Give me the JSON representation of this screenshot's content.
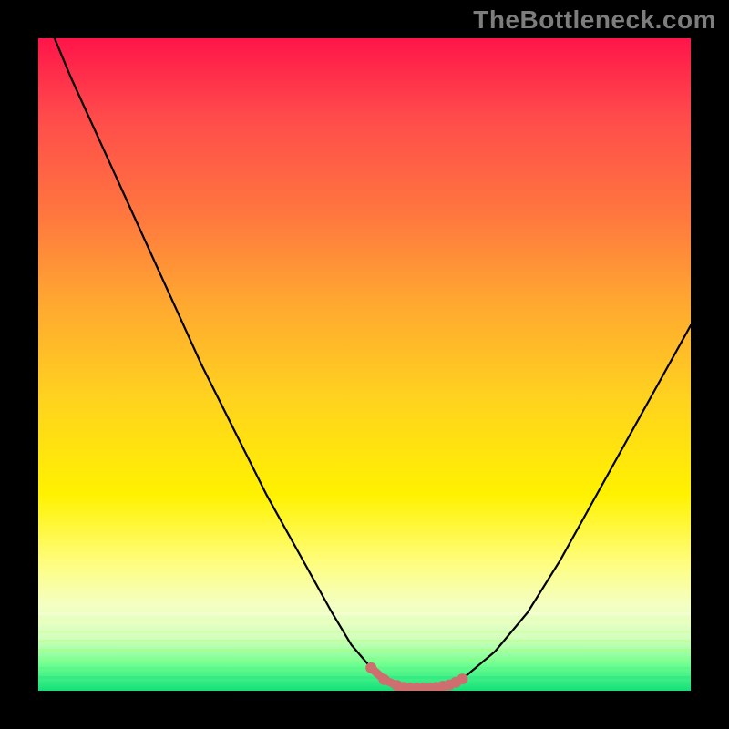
{
  "watermark": "TheBottleneck.com",
  "colors": {
    "frame": "#000000",
    "curve": "#000000",
    "highlight": "#ce6e6e",
    "gradient_top": "#ff154a",
    "gradient_bottom": "#14e07a"
  },
  "chart_data": {
    "type": "line",
    "title": "",
    "xlabel": "",
    "ylabel": "",
    "xlim": [
      0,
      100
    ],
    "ylim": [
      0,
      100
    ],
    "series": [
      {
        "name": "curve",
        "x": [
          0,
          5,
          10,
          15,
          20,
          25,
          30,
          35,
          40,
          45,
          48,
          51,
          53,
          55,
          57,
          59,
          61,
          63,
          65,
          70,
          75,
          80,
          85,
          90,
          95,
          100
        ],
        "y": [
          106,
          94,
          83,
          72,
          61,
          50,
          40,
          30,
          21,
          12,
          7,
          3.5,
          1.7,
          0.8,
          0.4,
          0.4,
          0.5,
          0.9,
          1.8,
          6,
          12,
          20,
          29,
          38,
          47,
          56
        ]
      },
      {
        "name": "minimum-highlight",
        "x": [
          51,
          53,
          55,
          56,
          57,
          58,
          59,
          60,
          61,
          62,
          63,
          64,
          65
        ],
        "y": [
          3.5,
          1.7,
          0.8,
          0.5,
          0.4,
          0.4,
          0.4,
          0.4,
          0.5,
          0.7,
          0.9,
          1.3,
          1.8
        ]
      }
    ]
  }
}
